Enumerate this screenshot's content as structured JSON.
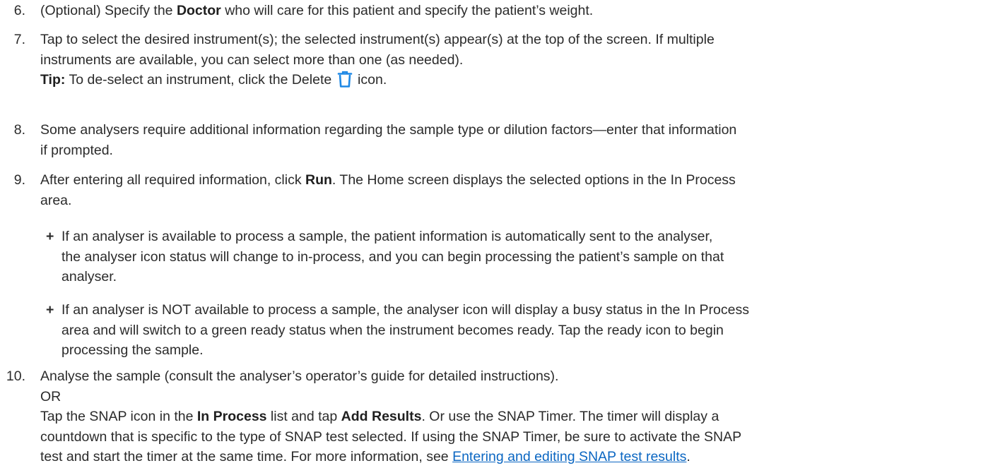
{
  "steps": [
    {
      "num": "6.",
      "lines": [
        {
          "pre": "(Optional) Specify the ",
          "bold": "Doctor",
          "post": " who will care for this patient and specify the patient’s weight."
        }
      ]
    },
    {
      "num": "7.",
      "lines": [
        "Tap to select the desired instrument(s); the selected instrument(s) appear(s) at the top of the screen. If multiple",
        "instruments are available, you can select more than one (as needed)."
      ],
      "tip": {
        "label": "Tip:",
        "pre": " To de-select an instrument, click the Delete ",
        "post": " icon."
      }
    },
    {
      "num": "8.",
      "lines": [
        "Some analysers require additional information regarding the sample type or dilution factors—enter that information",
        "if prompted."
      ]
    },
    {
      "num": "9.",
      "lines": [
        {
          "pre": "After entering all required information, click ",
          "bold": "Run",
          "post": ". The Home screen displays the selected options in the In Process"
        },
        "area."
      ],
      "bullets": [
        [
          "If an analyser is available to process a sample, the patient information is automatically sent to the analyser,",
          "the analyser icon status will change to in-process, and you can begin processing the patient’s sample on that",
          "analyser."
        ],
        [
          "If an analyser is NOT available to process a sample, the analyser icon will display a busy status in the In Process",
          "area and will switch to a green ready status when the instrument becomes ready. Tap the ready icon to begin",
          "processing the sample."
        ]
      ]
    },
    {
      "num": "10.",
      "lines": [
        "Analyse the sample (consult the analyser’s operator’s guide for detailed instructions).",
        "OR"
      ],
      "para": {
        "l1_pre": "Tap the SNAP icon in the ",
        "l1_b1": "In Process",
        "l1_mid": " list and tap ",
        "l1_b2": "Add Results",
        "l1_post": ". Or use the SNAP Timer. The timer will display a",
        "l2": "countdown that is specific to the type of SNAP test selected. If using the SNAP Timer, be sure to activate the SNAP",
        "l3_pre": "test and start the timer at the same time. For more information, see ",
        "l3_link": "Entering and editing SNAP test results",
        "l3_post": "."
      }
    }
  ],
  "bullet_glyph": "+",
  "colors": {
    "text": "#2b2b2b",
    "link": "#0a66c2",
    "icon": "#1e88e5"
  },
  "icons": {
    "delete": "trash-icon"
  }
}
